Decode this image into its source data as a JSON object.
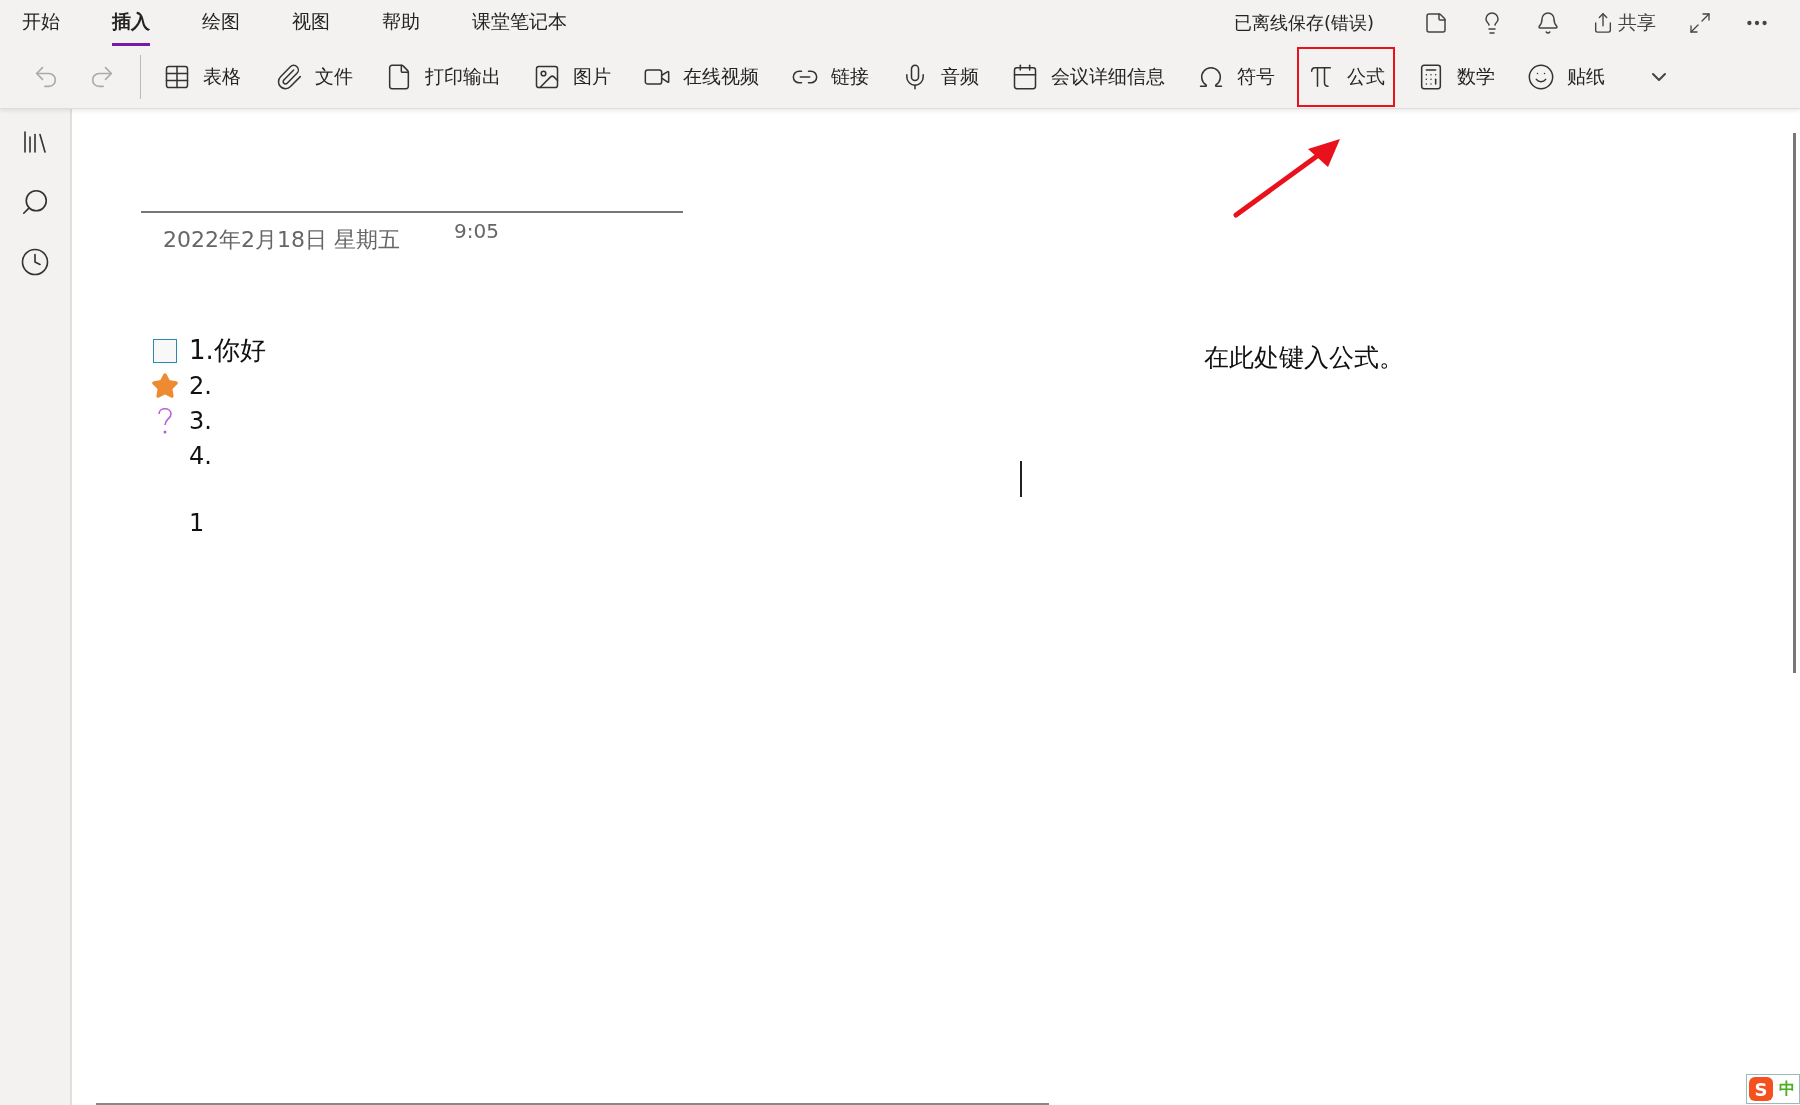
{
  "menu_tabs": [
    {
      "label": "开始",
      "selected": false
    },
    {
      "label": "插入",
      "selected": true
    },
    {
      "label": "绘图",
      "selected": false
    },
    {
      "label": "视图",
      "selected": false
    },
    {
      "label": "帮助",
      "selected": false
    },
    {
      "label": "课堂笔记本",
      "selected": false
    }
  ],
  "save_status": "已离线保存(错误)",
  "share_label": "共享",
  "toolbar": [
    {
      "label": "表格"
    },
    {
      "label": "文件"
    },
    {
      "label": "打印输出"
    },
    {
      "label": "图片"
    },
    {
      "label": "在线视频"
    },
    {
      "label": "链接"
    },
    {
      "label": "音频"
    },
    {
      "label": "会议详细信息"
    },
    {
      "label": "符号"
    },
    {
      "label": "公式",
      "highlighted": true
    },
    {
      "label": "数学"
    },
    {
      "label": "贴纸"
    }
  ],
  "page": {
    "date": "2022年2月18日 星期五",
    "time": "9:05",
    "lines": [
      {
        "kind": "checkbox",
        "checked": false,
        "text": "1.你好"
      },
      {
        "kind": "star",
        "text": "2."
      },
      {
        "kind": "question",
        "text": "3."
      },
      {
        "kind": "plain",
        "text": "4."
      },
      {
        "kind": "blank"
      },
      {
        "kind": "plain",
        "text": "1"
      }
    ],
    "formula_placeholder": "在此处键入公式。"
  },
  "ime": {
    "logo": "S",
    "mode": "中"
  }
}
